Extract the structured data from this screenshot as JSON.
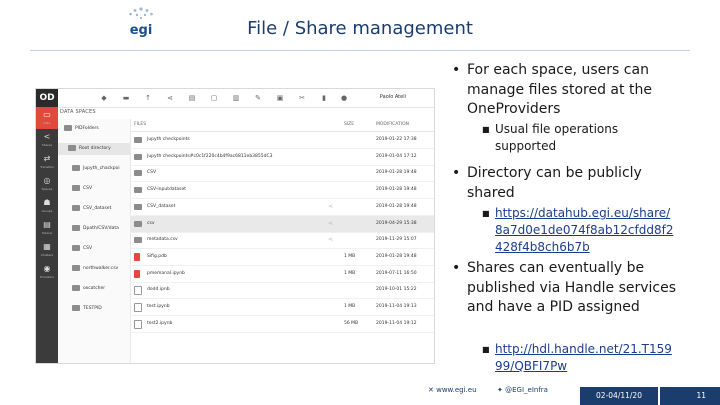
{
  "slide": {
    "title": "File / Share management",
    "logo_text": "egi",
    "bullets": [
      {
        "text": "For each space, users can manage files stored at the OneProviders"
      },
      {
        "text": "Usual file operations supported"
      },
      {
        "text": "Directory can be publicly shared"
      },
      {
        "text": "https://datahub.egi.eu/share/8a7d0e1de074f8ab12cfdd8f2428f4b8ch6b7b"
      },
      {
        "text": "Shares can eventually be published via Handle services and have a PID assigned"
      },
      {
        "text": "http://hdl.handle.net/21.T15999/QBFI7Pw"
      }
    ],
    "footer": {
      "website": "www.egi.eu",
      "twitter": "@EGI_eInfra",
      "date": "02-04/11/20",
      "page": "11"
    }
  },
  "app": {
    "logo": "OD",
    "user": "Paolo Ateli",
    "breadcrumb": "DATA SPACES",
    "rail": [
      {
        "label": "Data",
        "icon": "▭"
      },
      {
        "label": "Shares",
        "icon": "<"
      },
      {
        "label": "Transfers",
        "icon": "⇄"
      },
      {
        "label": "Spaces",
        "icon": "◎"
      },
      {
        "label": "Groups",
        "icon": "☗"
      },
      {
        "label": "Tokens",
        "icon": "▤"
      },
      {
        "label": "Clusters",
        "icon": "▦"
      },
      {
        "label": "Providers",
        "icon": "◉"
      }
    ],
    "tree": [
      {
        "label": "PIDFolders",
        "selected": false
      },
      {
        "label": "Root directory",
        "selected": true
      },
      {
        "label": "Jupyth_chackpoi",
        "selected": false
      },
      {
        "label": "CSV",
        "selected": false
      },
      {
        "label": "CSV_dataset",
        "selected": false
      },
      {
        "label": "Dpath/CSV/data",
        "selected": false
      },
      {
        "label": "CSV",
        "selected": false
      },
      {
        "label": "northwalker.csv",
        "selected": false
      },
      {
        "label": "oxcatcher",
        "selected": false
      },
      {
        "label": "TESTPID",
        "selected": false
      }
    ],
    "columns": {
      "files": "FILES",
      "size": "SIZE",
      "modification": "MODIFICATION"
    },
    "files": [
      {
        "name": "Jupyth checkpoints",
        "size": "",
        "mod": "2019-01-22 17:38",
        "kind": "folder",
        "shared": false,
        "hl": false
      },
      {
        "name": "Jupyth checkpoints#c0c1f220c4b4f9ac6811eb3855dC3",
        "size": "",
        "mod": "2019-01-04 17:12",
        "kind": "folder",
        "shared": false,
        "hl": false
      },
      {
        "name": "CSV",
        "size": "",
        "mod": "2019-01-28 19:48",
        "kind": "folder",
        "shared": false,
        "hl": false
      },
      {
        "name": "CSV-inputdataset",
        "size": "",
        "mod": "2019-01-28 19:48",
        "kind": "folder",
        "shared": false,
        "hl": false
      },
      {
        "name": "CSV_dataset",
        "size": "",
        "mod": "2019-01-28 19:48",
        "kind": "folder",
        "shared": true,
        "hl": false
      },
      {
        "name": "csv",
        "size": "",
        "mod": "2019-04-29 15:38",
        "kind": "folder",
        "shared": true,
        "hl": true
      },
      {
        "name": "metadata.csv",
        "size": "",
        "mod": "2019-11-29 15:07",
        "kind": "folder",
        "shared": true,
        "hl": false
      },
      {
        "name": "Sifig.pdb",
        "size": "1 MB",
        "mod": "2019-01-28 19:48",
        "kind": "red",
        "shared": false,
        "hl": false
      },
      {
        "name": "pmemanal.ipynb",
        "size": "1 MB",
        "mod": "2019-07-11 16:50",
        "kind": "red",
        "shared": false,
        "hl": false
      },
      {
        "name": "dodd.ipnb",
        "size": "",
        "mod": "2019-10-01 15:22",
        "kind": "file",
        "shared": false,
        "hl": false
      },
      {
        "name": "test.ipynb",
        "size": "1 MB",
        "mod": "2019-11-04 19:13",
        "kind": "file",
        "shared": false,
        "hl": false
      },
      {
        "name": "test2.ipynb",
        "size": "56 MB",
        "mod": "2019-11-04 19:12",
        "kind": "file",
        "shared": false,
        "hl": false
      }
    ]
  }
}
